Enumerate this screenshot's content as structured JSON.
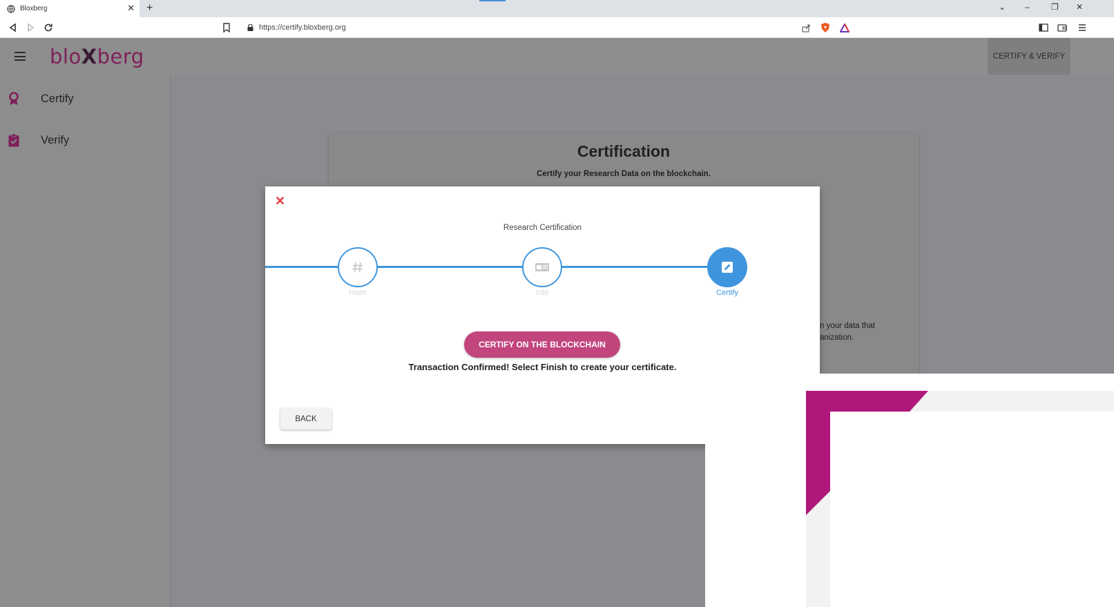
{
  "browser": {
    "tab_title": "Bloxberg",
    "url": "https://certify.bloxberg.org"
  },
  "app": {
    "logo_text_left": "blo",
    "logo_text_x": "X",
    "logo_text_right": "berg",
    "header_nav": "CERTIFY & VERIFY",
    "brand_color": "#7e1f5a"
  },
  "sidebar": {
    "items": [
      {
        "label": "Certify",
        "icon": "award-icon"
      },
      {
        "label": "Verify",
        "icon": "clipboard-check-icon"
      }
    ]
  },
  "card": {
    "title": "Certification",
    "subtitle": "Certify your Research Data on the blockchain.",
    "fragment_line1": "n your data that",
    "fragment_line2": "anization."
  },
  "dialog": {
    "close_symbol": "✕",
    "title": "Research Certification",
    "steps": [
      {
        "label": "Hash",
        "icon": "hash-icon",
        "active": false
      },
      {
        "label": "Info",
        "icon": "id-card-icon",
        "active": false
      },
      {
        "label": "Certify",
        "icon": "edit-icon",
        "active": true
      }
    ],
    "certify_button": "CERTIFY ON THE BLOCKCHAIN",
    "status": "Transaction Confirmed! Select Finish to create your certificate.",
    "back_button": "BACK",
    "accent_color": "#3f95dd",
    "button_color": "#c2457e"
  }
}
